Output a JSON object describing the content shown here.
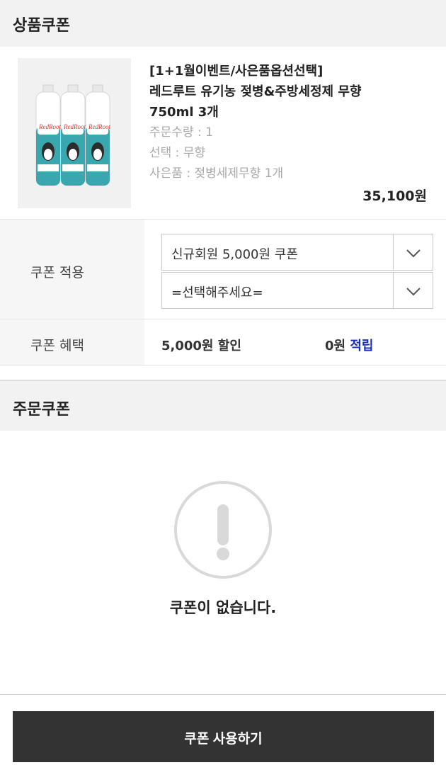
{
  "product_coupon": {
    "title": "상품쿠폰",
    "product": {
      "name_line1": "[1+1월이벤트/사은품옵션선택]",
      "name_line2": "레드루트 유기농 젖병&주방세정제 무향",
      "name_line3": "750ml 3개",
      "quantity": "주문수량 : 1",
      "option": "선택 : 무향",
      "gift": "사은품 : 젖병세제무향 1개",
      "price": "35,100원",
      "image_brand_text": "RedRoot"
    },
    "apply_label": "쿠폰 적용",
    "select1_value": "신규회원 5,000원 쿠폰",
    "select2_value": "=선택해주세요=",
    "benefit_label": "쿠폰 혜택",
    "discount": "5,000원 할인",
    "points_amount": "0원",
    "points_label": "적립"
  },
  "order_coupon": {
    "title": "주문쿠폰",
    "empty_message": "쿠폰이 없습니다."
  },
  "cta": {
    "label": "쿠폰 사용하기"
  },
  "colors": {
    "accent_blue": "#1a2fb8",
    "cta_bg": "#333333",
    "header_bg": "#f2f2f2",
    "bottle_teal": "#3aa6ad"
  },
  "icons": {
    "dropdown": "chevron-down-icon",
    "empty": "exclamation-circle-icon"
  }
}
